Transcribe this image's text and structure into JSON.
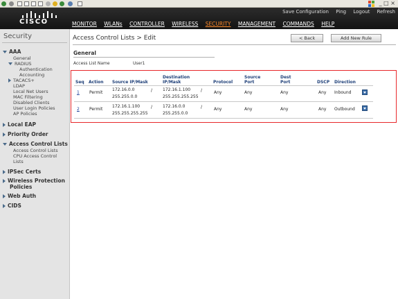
{
  "top_links": [
    "Save Configuration",
    "Ping",
    "Logout",
    "Refresh"
  ],
  "brand": "CISCO",
  "nav": [
    {
      "label": "MONITOR",
      "active": false
    },
    {
      "label": "WLANs",
      "active": false
    },
    {
      "label": "CONTROLLER",
      "active": false
    },
    {
      "label": "WIRELESS",
      "active": false
    },
    {
      "label": "SECURITY",
      "active": true
    },
    {
      "label": "MANAGEMENT",
      "active": false
    },
    {
      "label": "COMMANDS",
      "active": false
    },
    {
      "label": "HELP",
      "active": false
    }
  ],
  "sidebar": {
    "title": "Security",
    "aaa": "AAA",
    "general": "General",
    "radius": "RADIUS",
    "authentication": "Authentication",
    "accounting": "Accounting",
    "tacacs": "TACACS+",
    "ldap": "LDAP",
    "local_net_users": "Local Net Users",
    "mac_filtering": "MAC Filtering",
    "disabled_clients": "Disabled Clients",
    "user_login_policies": "User Login Policies",
    "ap_policies": "AP Policies",
    "local_eap": "Local EAP",
    "priority_order": "Priority Order",
    "acl": "Access Control Lists",
    "acl_sub": "Access Control Lists",
    "cpu_acl_1": "CPU Access Control",
    "cpu_acl_2": "Lists",
    "ipsec": "IPSec Certs",
    "wpp_1": "Wireless Protection",
    "wpp_2": "Policies",
    "web_auth": "Web Auth",
    "cids": "CIDS"
  },
  "page": {
    "title": "Access Control Lists > Edit",
    "back_label": "< Back",
    "add_rule_label": "Add New Rule",
    "section_general": "General",
    "acl_name_label": "Access List Name",
    "acl_name_value": "User1"
  },
  "table": {
    "headers": {
      "seq": "Seq",
      "action": "Action",
      "source": "Source IP/Mask",
      "dest_1": "Destination",
      "dest_2": "IP/Mask",
      "protocol": "Protocol",
      "sport_1": "Source",
      "sport_2": "Port",
      "dport_1": "Dest",
      "dport_2": "Port",
      "dscp": "DSCP",
      "direction": "Direction"
    },
    "rows": [
      {
        "seq": "1",
        "action": "Permit",
        "src_ip": "172.16.0.0",
        "src_mask": "255.255.0.0",
        "sep1": "/",
        "dst_ip": "172.16.1.100",
        "dst_mask": "255.255.255.255",
        "sep2": "/",
        "protocol": "Any",
        "sport": "Any",
        "dport": "Any",
        "dscp": "Any",
        "direction": "Inbound"
      },
      {
        "seq": "2",
        "action": "Permit",
        "src_ip": "172.16.1.100",
        "src_mask": "255.255.255.255",
        "sep1": "/",
        "dst_ip": "172.16.0.0",
        "dst_mask": "255.255.0.0",
        "sep2": "/",
        "protocol": "Any",
        "sport": "Any",
        "dport": "Any",
        "dscp": "Any",
        "direction": "Outbound"
      }
    ]
  },
  "colors": {
    "highlight_box": "#e8272a",
    "active_nav": "#ff8a2a",
    "header_text": "#1e3f78"
  }
}
